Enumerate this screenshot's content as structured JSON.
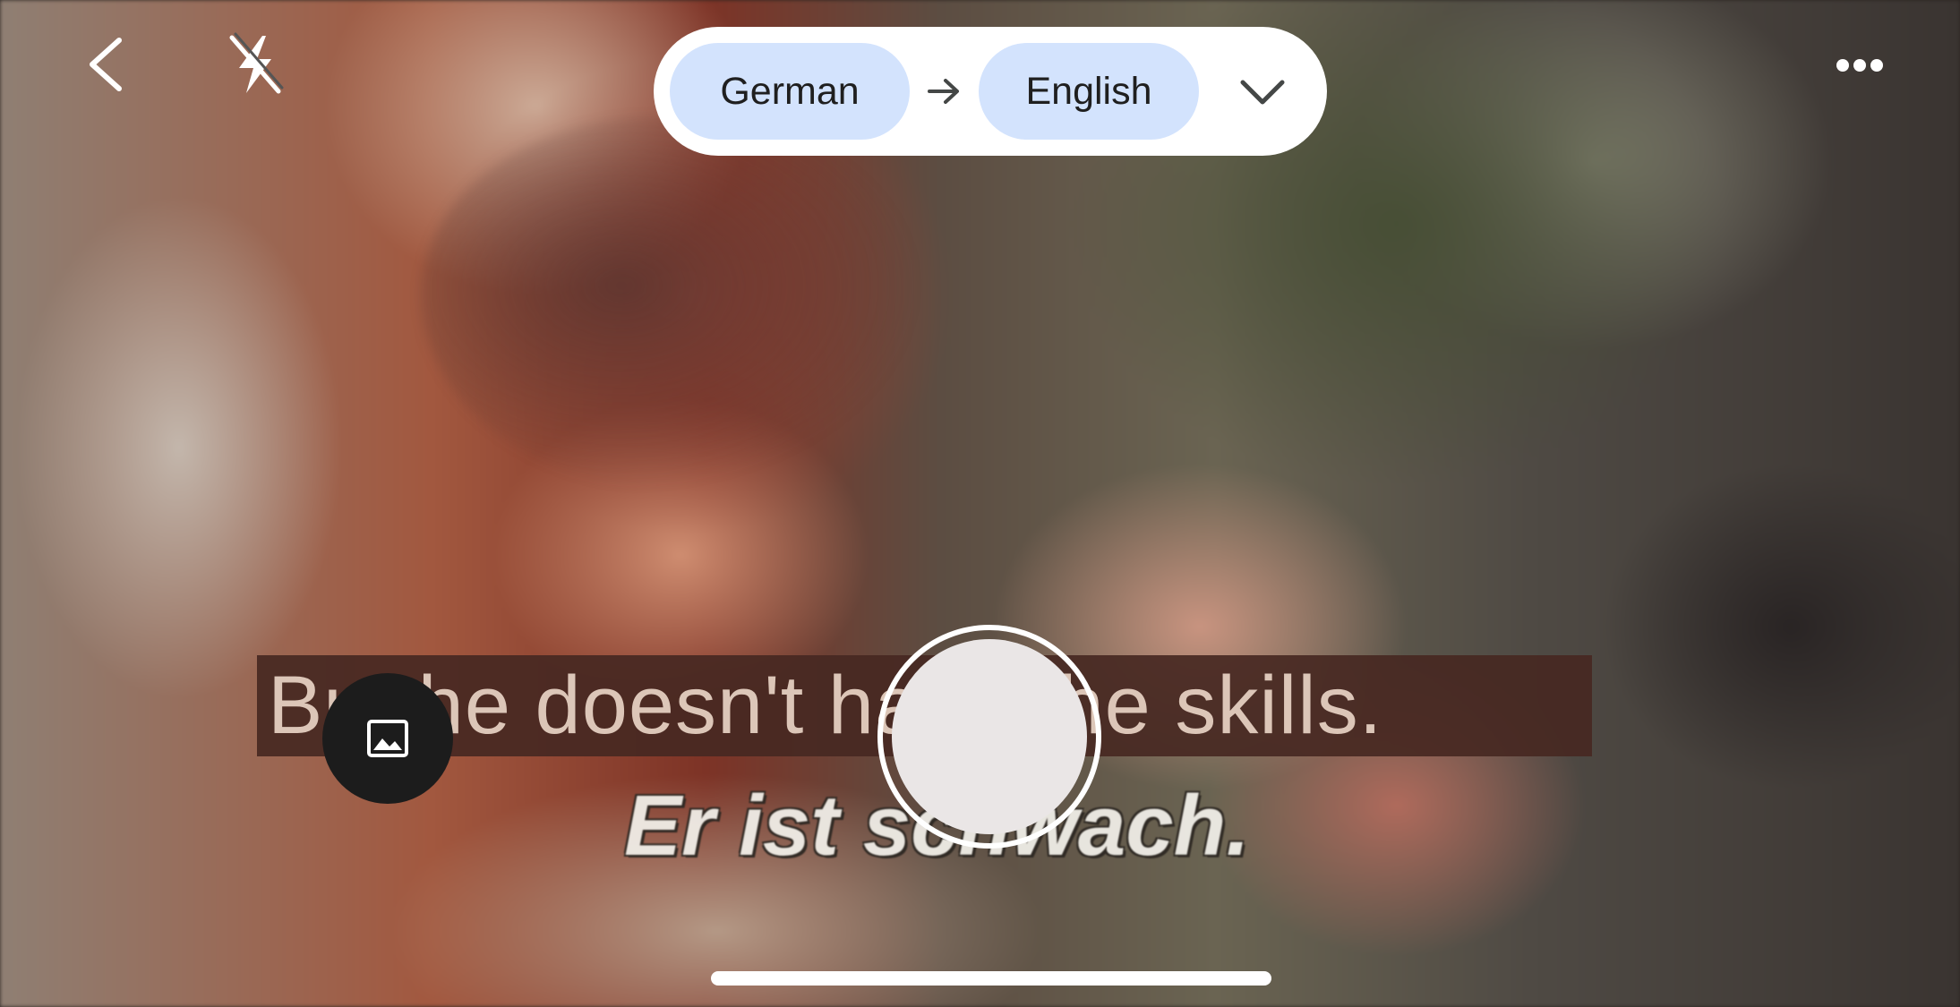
{
  "top_bar": {
    "back_icon": "chevron-left-icon",
    "flash_icon": "flash-off-icon",
    "more_icon": "more-horizontal-icon"
  },
  "language_selector": {
    "source_language": "German",
    "target_language": "English",
    "swap_icon": "arrow-right-icon",
    "dropdown_icon": "chevron-down-icon",
    "chip_color": "#d3e3fd"
  },
  "viewfinder": {
    "translated_caption": "But he doesn't have the skills.",
    "source_caption": "Er ist schwach."
  },
  "controls": {
    "gallery_icon": "image-icon",
    "shutter_icon": "shutter-button"
  }
}
